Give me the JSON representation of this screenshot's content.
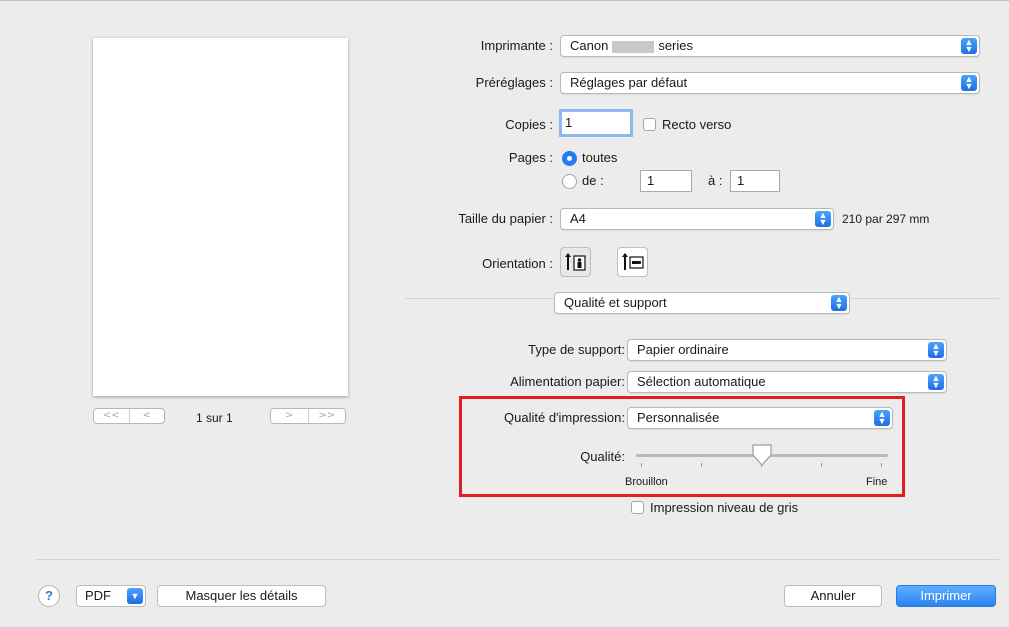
{
  "printer": {
    "label": "Imprimante :",
    "value_prefix": "Canon",
    "value_suffix": "series"
  },
  "presets": {
    "label": "Préréglages :",
    "value": "Réglages par défaut"
  },
  "copies": {
    "label": "Copies :",
    "value": "1",
    "duplex_label": "Recto verso"
  },
  "pages": {
    "label": "Pages :",
    "all_label": "toutes",
    "from_label": "de :",
    "from_value": "1",
    "to_label": "à :",
    "to_value": "1"
  },
  "paper_size": {
    "label": "Taille du papier :",
    "value": "A4",
    "dimensions": "210 par 297 mm"
  },
  "orientation": {
    "label": "Orientation :",
    "selected": "portrait"
  },
  "section": {
    "value": "Qualité et support"
  },
  "media_type": {
    "label": "Type de support:",
    "value": "Papier ordinaire"
  },
  "paper_source": {
    "label": "Alimentation papier:",
    "value": "Sélection automatique"
  },
  "print_quality": {
    "label": "Qualité d'impression:",
    "value": "Personnalisée"
  },
  "quality_slider": {
    "label": "Qualité:",
    "min_label": "Brouillon",
    "max_label": "Fine",
    "level": 0.5,
    "ticks": 5
  },
  "grayscale": {
    "label": "Impression niveau de gris",
    "checked": false
  },
  "preview": {
    "page_count": "1 sur 1",
    "prev_first": "<<",
    "prev": "<",
    "next": ">",
    "next_last": ">>"
  },
  "footer": {
    "help": "?",
    "pdf": "PDF",
    "details_button": "Masquer les détails",
    "cancel_button": "Annuler",
    "print_button": "Imprimer"
  },
  "colors": {
    "accent": "#1f7cf2",
    "highlight_box": "#e02020"
  }
}
